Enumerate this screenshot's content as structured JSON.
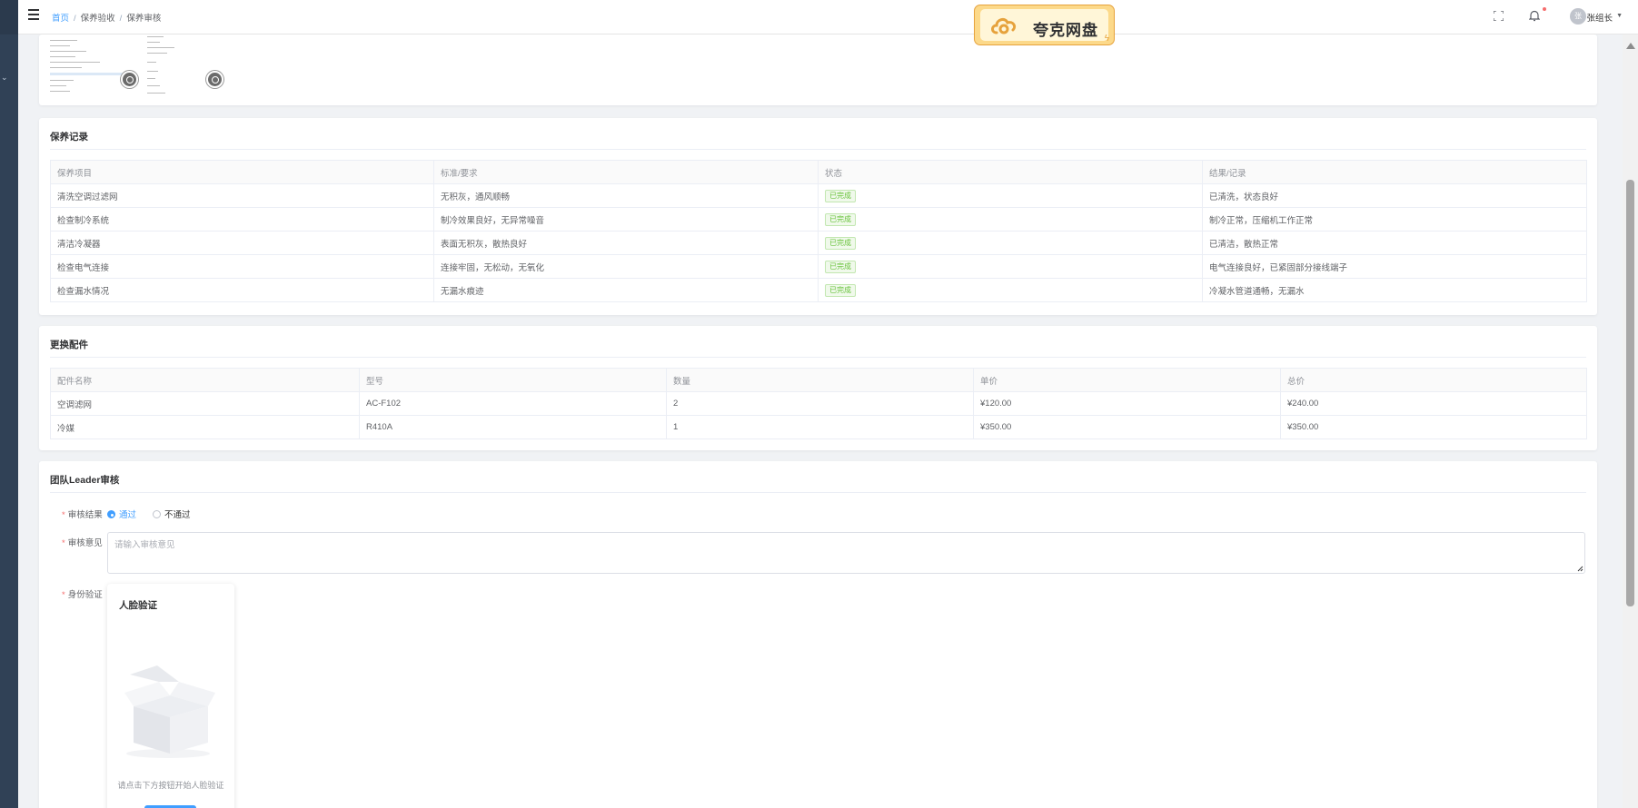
{
  "breadcrumb": [
    "首页",
    "保养验收",
    "保养审核"
  ],
  "header": {
    "user_name": "张组长",
    "avatar_text": "张"
  },
  "overlay": {
    "brand": "夸克网盘"
  },
  "maintenance_records": {
    "title": "保养记录",
    "columns": [
      "保养项目",
      "标准/要求",
      "状态",
      "结果/记录"
    ],
    "rows": [
      [
        "清洗空调过滤网",
        "无积灰，通风顺畅",
        "已完成",
        "已清洗，状态良好"
      ],
      [
        "检查制冷系统",
        "制冷效果良好，无异常噪音",
        "已完成",
        "制冷正常，压缩机工作正常"
      ],
      [
        "清洁冷凝器",
        "表面无积灰，散热良好",
        "已完成",
        "已清洁，散热正常"
      ],
      [
        "检查电气连接",
        "连接牢固，无松动，无氧化",
        "已完成",
        "电气连接良好，已紧固部分接线端子"
      ],
      [
        "检查漏水情况",
        "无漏水痕迹",
        "已完成",
        "冷凝水管道通畅，无漏水"
      ]
    ]
  },
  "parts": {
    "title": "更换配件",
    "columns": [
      "配件名称",
      "型号",
      "数量",
      "单价",
      "总价"
    ],
    "rows": [
      [
        "空调滤网",
        "AC-F102",
        "2",
        "¥120.00",
        "¥240.00"
      ],
      [
        "冷媒",
        "R410A",
        "1",
        "¥350.00",
        "¥350.00"
      ]
    ]
  },
  "review": {
    "title": "团队Leader审核",
    "result_label": "审核结果",
    "options": [
      "通过",
      "不通过"
    ],
    "selected": "通过",
    "comment_label": "审核意见",
    "comment_placeholder": "请输入审核意见",
    "identity_label": "身份验证",
    "face": {
      "title": "人脸验证",
      "tip": "请点击下方按钮开始人脸验证"
    }
  },
  "colors": {
    "primary": "#409eff",
    "success": "#67c23a",
    "danger": "#f56c6c",
    "sidebar": "#304156"
  }
}
